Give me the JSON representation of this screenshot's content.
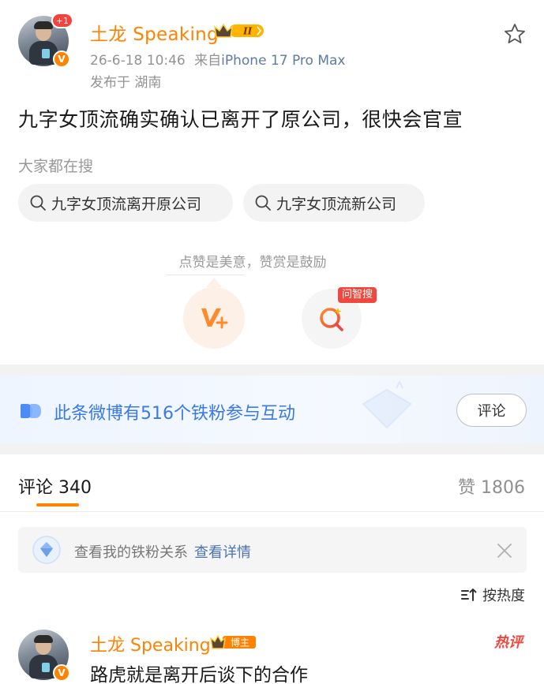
{
  "post": {
    "author": "土龙 Speaking",
    "avatar_plus": "+1",
    "verified_mark": "V",
    "level_badge": "II",
    "meta_time": "26-6-18 10:46",
    "meta_from": "来自",
    "meta_device": "iPhone 17 Pro Max",
    "location": "发布于 湖南",
    "text": "九字女顶流确实确认已离开了原公司，很快会官宣"
  },
  "search": {
    "label": "大家都在搜",
    "chips": [
      "九字女顶流离开原公司",
      "九字女顶流新公司"
    ]
  },
  "reward": {
    "tip": "点赞是美意，赞赏是鼓励",
    "ask_tag": "问智搜"
  },
  "fans": {
    "text": "此条微博有516个铁粉参与互动",
    "comment_button": "评论"
  },
  "tabs": {
    "comments": "评论 340",
    "likes": "赞 1806"
  },
  "relation": {
    "text": "查看我的铁粉关系",
    "link": "查看详情"
  },
  "sort": {
    "label": "按热度"
  },
  "comment": {
    "author": "土龙 Speaking",
    "badge": "博主",
    "text": "路虎就是离开后谈下的合作",
    "hot_tag": "热评"
  },
  "colors": {
    "brand_orange": "#ff8200",
    "link_blue": "#3a79e8",
    "hot_red": "#f0483e"
  },
  "icons": [
    "star-icon",
    "search-icon",
    "reward-icon",
    "ask-search-icon",
    "fan-icon",
    "diamond-icon",
    "close-icon",
    "sort-icon",
    "crown-icon"
  ]
}
